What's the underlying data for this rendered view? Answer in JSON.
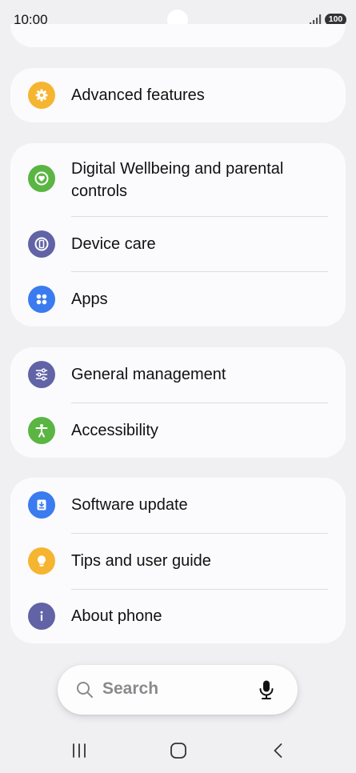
{
  "status_bar": {
    "time": "10:00",
    "battery": "100"
  },
  "sections": [
    {
      "items": [
        {
          "label": "Advanced features",
          "icon": "gear-star-icon",
          "color": "#f6b530"
        }
      ]
    },
    {
      "items": [
        {
          "label": "Digital Wellbeing and parental controls",
          "icon": "heart-circle-icon",
          "color": "#5bb543"
        },
        {
          "label": "Device care",
          "icon": "device-care-icon",
          "color": "#6163a6"
        },
        {
          "label": "Apps",
          "icon": "apps-grid-icon",
          "color": "#3a7bef"
        }
      ]
    },
    {
      "items": [
        {
          "label": "General management",
          "icon": "sliders-icon",
          "color": "#6163a6"
        },
        {
          "label": "Accessibility",
          "icon": "accessibility-person-icon",
          "color": "#5bb543"
        }
      ]
    },
    {
      "items": [
        {
          "label": "Software update",
          "icon": "download-icon",
          "color": "#3a7bef"
        },
        {
          "label": "Tips and user guide",
          "icon": "lightbulb-icon",
          "color": "#f6b530"
        },
        {
          "label": "About phone",
          "icon": "info-icon",
          "color": "#6163a6"
        }
      ]
    }
  ],
  "search": {
    "label": "Search",
    "icon": "search-icon",
    "voice_icon": "microphone-icon"
  },
  "nav_bar": {
    "recents_icon": "recents-icon",
    "home_icon": "home-icon",
    "back_icon": "back-icon"
  }
}
